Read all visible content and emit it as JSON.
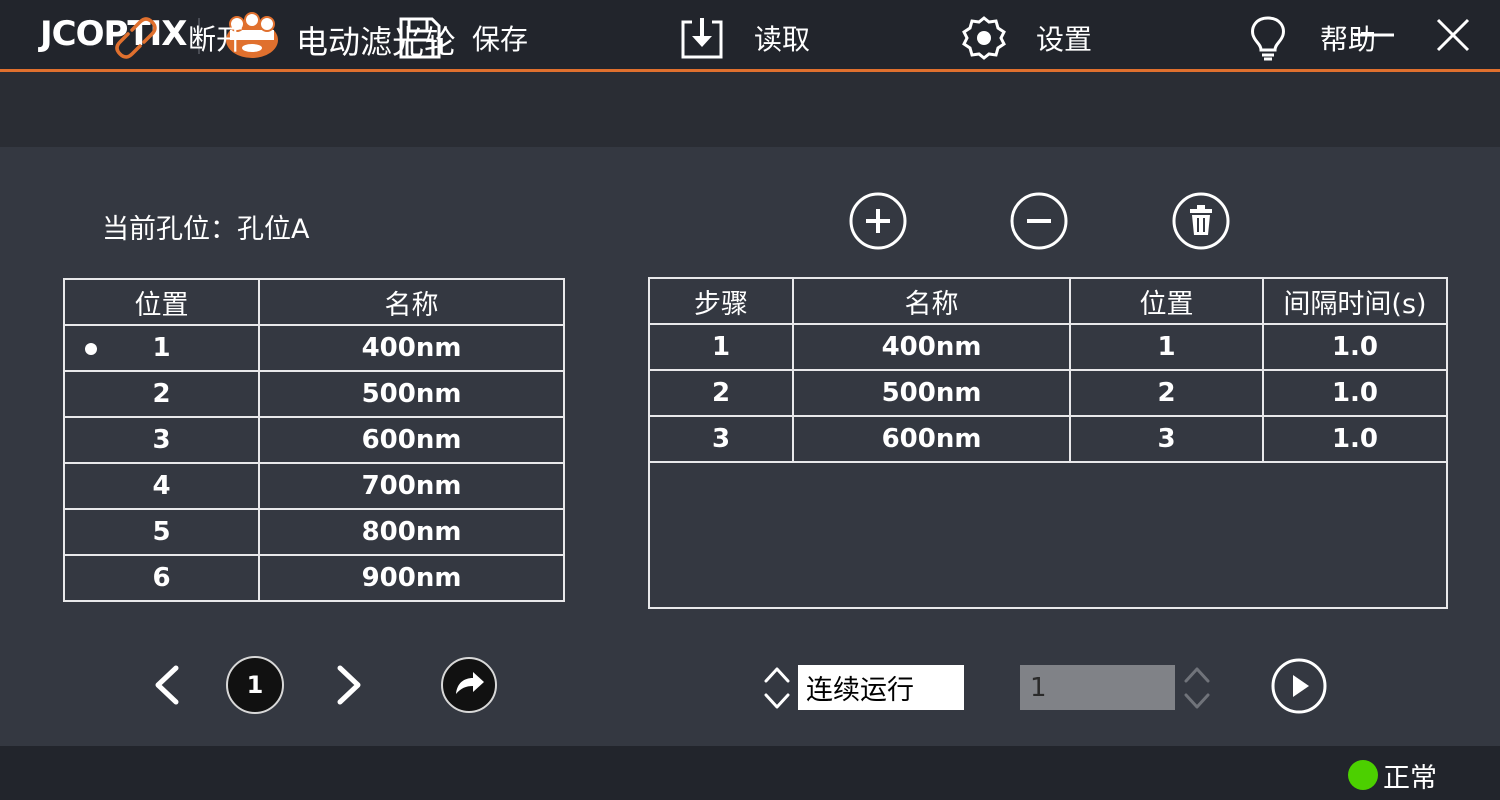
{
  "window": {
    "logo": "JCOPTIX",
    "title": "电动滤光轮",
    "accent_color": "#e0702e",
    "controls": [
      "minimize-icon",
      "close-icon"
    ]
  },
  "toolbar": {
    "items": [
      {
        "label": "断开",
        "icon": "link-break-icon"
      },
      {
        "label": "保存",
        "icon": "save-icon"
      },
      {
        "label": "读取",
        "icon": "download-box-icon"
      },
      {
        "label": "设置",
        "icon": "gear-icon"
      },
      {
        "label": "帮助",
        "icon": "lightbulb-icon"
      }
    ]
  },
  "current_position": {
    "label": "当前孔位：",
    "value": "孔位A"
  },
  "sequence_actions": [
    "add-circle-icon",
    "remove-circle-icon",
    "trash-icon"
  ],
  "positions_table": {
    "headers": [
      "位置",
      "名称"
    ],
    "rows": [
      {
        "pos": "1",
        "name": "400nm",
        "selected": true
      },
      {
        "pos": "2",
        "name": "500nm",
        "selected": false
      },
      {
        "pos": "3",
        "name": "600nm",
        "selected": false
      },
      {
        "pos": "4",
        "name": "700nm",
        "selected": false
      },
      {
        "pos": "5",
        "name": "800nm",
        "selected": false
      },
      {
        "pos": "6",
        "name": "900nm",
        "selected": false
      }
    ]
  },
  "sequence_table": {
    "headers": [
      "步骤",
      "名称",
      "位置",
      "间隔时间(s)"
    ],
    "rows": [
      {
        "step": "1",
        "name": "400nm",
        "pos": "1",
        "interval": "1.0"
      },
      {
        "step": "2",
        "name": "500nm",
        "pos": "2",
        "interval": "1.0"
      },
      {
        "step": "3",
        "name": "600nm",
        "pos": "3",
        "interval": "1.0"
      }
    ]
  },
  "pager": {
    "page": "1"
  },
  "run_controls": {
    "mode": "连续运行",
    "count": "1"
  },
  "status": {
    "text": "正常",
    "color": "#4cd000"
  }
}
